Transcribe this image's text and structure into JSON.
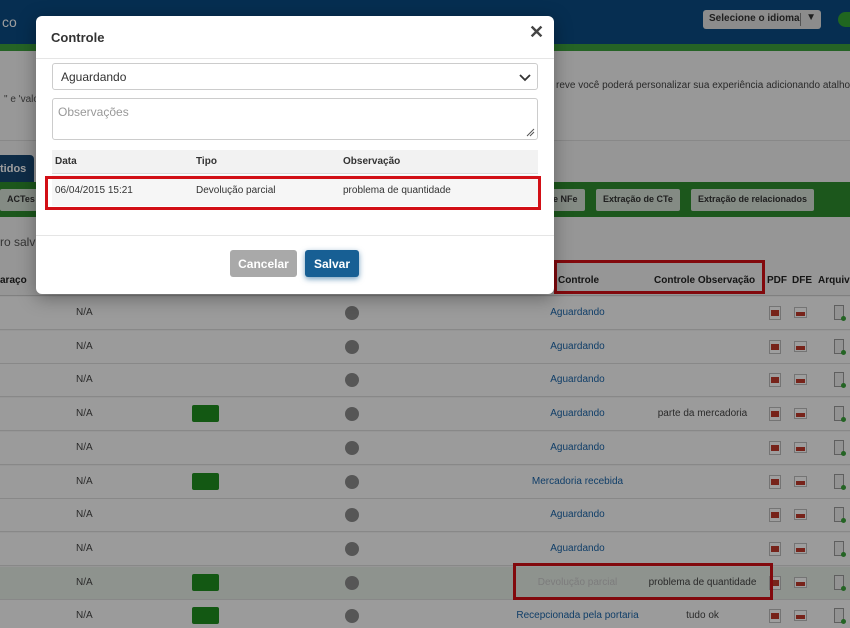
{
  "background": {
    "brand_fragment": "co",
    "language_select": "Selecione o idioma",
    "info_left": "\" e 'valo",
    "info_right": "reve você poderá personalizar sua experiência adicionando atalho",
    "tab_active": "tidos",
    "action_buttons": [
      "ACTes (P",
      "e NFe",
      "Extração de CTe",
      "Extração de relacionados"
    ],
    "saved_label": "ro salv",
    "table": {
      "headers": {
        "first": "araço",
        "controle": "Controle",
        "controle_obs": "Controle Observação",
        "pdf": "PDF",
        "dfe": "DFE",
        "arquivo": "Arquiv"
      },
      "rows": [
        {
          "col": "N/A",
          "green": false,
          "controle": "Aguardando",
          "obs": ""
        },
        {
          "col": "N/A",
          "green": false,
          "controle": "Aguardando",
          "obs": ""
        },
        {
          "col": "N/A",
          "green": false,
          "controle": "Aguardando",
          "obs": ""
        },
        {
          "col": "N/A",
          "green": true,
          "controle": "Aguardando",
          "obs": "parte da mercadoria"
        },
        {
          "col": "N/A",
          "green": false,
          "controle": "Aguardando",
          "obs": ""
        },
        {
          "col": "N/A",
          "green": true,
          "controle": "Mercadoria recebida",
          "obs": ""
        },
        {
          "col": "N/A",
          "green": false,
          "controle": "Aguardando",
          "obs": ""
        },
        {
          "col": "N/A",
          "green": false,
          "controle": "Aguardando",
          "obs": ""
        },
        {
          "col": "N/A",
          "green": true,
          "controle": "Devolução parcial",
          "obs": "problema de quantidade",
          "highlight": true
        },
        {
          "col": "N/A",
          "green": true,
          "controle": "Recepcionada pela portaria",
          "obs": "tudo ok"
        }
      ]
    }
  },
  "modal": {
    "title": "Controle",
    "status_selected": "Aguardando",
    "observations_placeholder": "Observações",
    "history_headers": {
      "date": "Data",
      "type": "Tipo",
      "observation": "Observação"
    },
    "history_rows": [
      {
        "date": "06/04/2015 15:21",
        "type": "Devolução parcial",
        "observation": "problema de quantidade"
      }
    ],
    "cancel_label": "Cancelar",
    "save_label": "Salvar"
  },
  "colors": {
    "header_blue": "#0b4b84",
    "action_green": "#2e8d2e",
    "highlight_red": "#d20f16",
    "save_blue": "#175f94"
  }
}
